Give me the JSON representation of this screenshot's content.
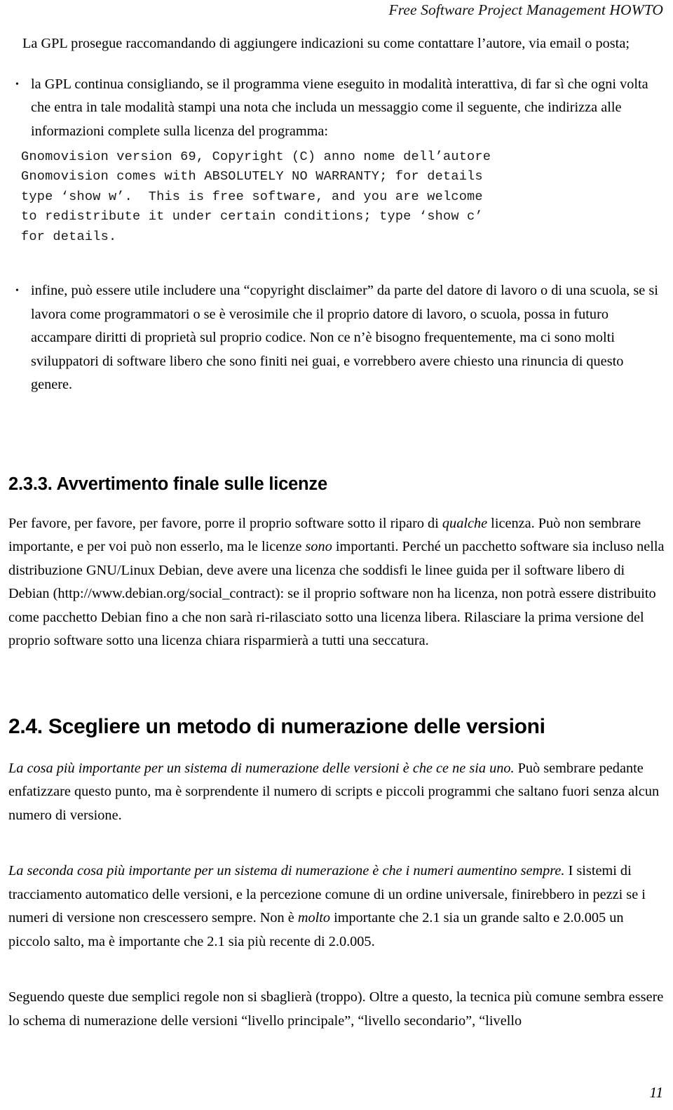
{
  "header": {
    "running_title": "Free Software Project Management HOWTO"
  },
  "footer": {
    "page_number": "11"
  },
  "body": {
    "para_gpl_contact": "La GPL prosegue raccomandando di aggiungere indicazioni su come contattare l’autore, via email o posta;",
    "bullet_interactive": "la GPL continua consigliando, se il programma viene eseguito in modalità interattiva, di far sì che ogni volta che entra in tale modalità stampi una nota che includa un messaggio come il seguente, che indirizza alle informazioni complete sulla licenza del programma:",
    "code_block": "Gnomovision version 69, Copyright (C) anno nome dell’autore\nGnomovision comes with ABSOLUTELY NO WARRANTY; for details\ntype ‘show w’.  This is free software, and you are welcome\nto redistribute it under certain conditions; type ‘show c’\nfor details.",
    "bullet_disclaimer": "infine, può essere utile includere una “copyright disclaimer” da parte del datore di lavoro o di una scuola, se si lavora come programmatori o se è verosimile che il proprio datore di lavoro, o scuola, possa in futuro accampare diritti di proprietà sul proprio codice. Non ce n’è bisogno frequentemente, ma ci sono molti sviluppatori di software libero che sono finiti nei guai, e vorrebbero avere chiesto una rinuncia di questo genere."
  },
  "section_233": {
    "heading": "2.3.3. Avvertimento finale sulle licenze",
    "para_1_a": "Per favore, per favore, per favore, porre il proprio software sotto il riparo di ",
    "para_1_em1": "qualche",
    "para_1_b": " licenza. Può non sembrare importante, e per voi può non esserlo, ma le licenze ",
    "para_1_em2": "sono",
    "para_1_c": " importanti. Perché un pacchetto software sia incluso nella distribuzione GNU/Linux Debian, deve avere una licenza che soddisfi le linee guida per il software libero di Debian (http://www.debian.org/social_contract): se il proprio software non ha licenza, non potrà essere distribuito come pacchetto Debian fino a che non sarà ri-rilasciato sotto una licenza libera. Rilasciare la prima versione del proprio software sotto una licenza chiara risparmierà a tutti una seccatura."
  },
  "section_24": {
    "heading": "2.4. Scegliere un metodo di numerazione delle versioni",
    "para_1_em": "La cosa più importante per un sistema di numerazione delle versioni è che ce ne sia uno.",
    "para_1_rest": " Può sembrare pedante enfatizzare questo punto, ma è sorprendente il numero di scripts e piccoli programmi che saltano fuori senza alcun numero di versione.",
    "para_2_em": "La seconda cosa più importante per un sistema di numerazione è che i numeri aumentino sempre.",
    "para_2_a": " I sistemi di tracciamento automatico delle versioni, e la percezione comune di un ordine universale, finirebbero in pezzi se i numeri di versione non crescessero sempre. Non è ",
    "para_2_em2": "molto",
    "para_2_b": " importante che 2.1 sia un grande salto e 2.0.005 un piccolo salto, ma è importante che 2.1 sia più recente di 2.0.005.",
    "para_3": "Seguendo queste due semplici regole non si sbaglierà (troppo). Oltre a questo, la tecnica più comune sembra essere lo schema di numerazione delle versioni “livello principale”, “livello secondario”, “livello"
  },
  "symbols": {
    "bullet": "•"
  }
}
